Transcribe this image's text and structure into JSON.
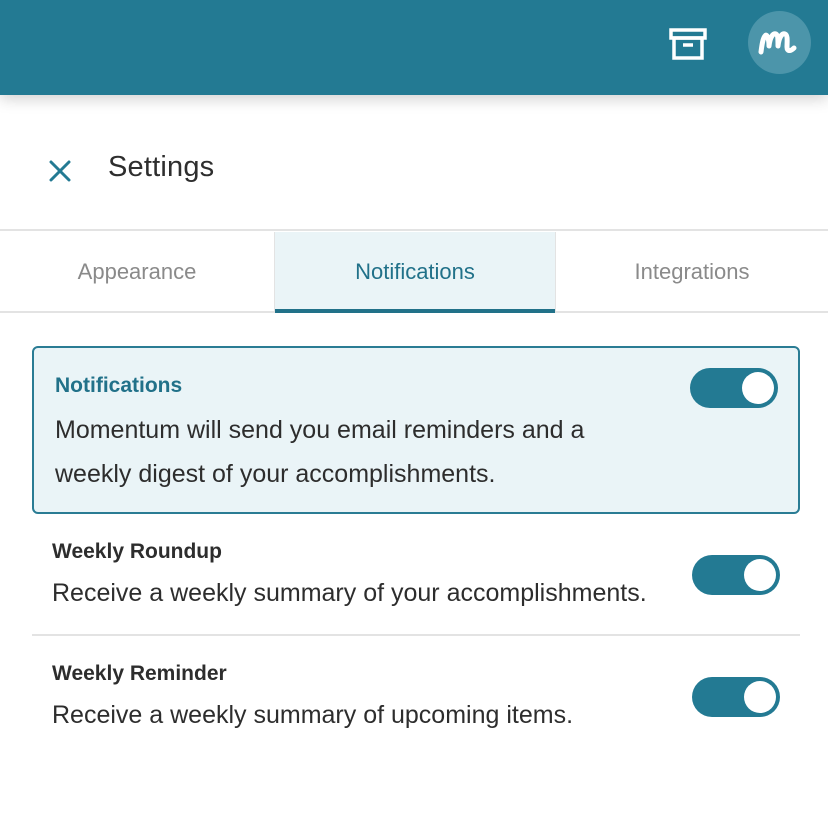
{
  "topbar": {
    "archive_icon": "archive-box-icon",
    "avatar_icon": "momentum-m-logo",
    "brand_color": "#237a93"
  },
  "header": {
    "title": "Settings",
    "close_icon": "close-x-icon"
  },
  "tabs": [
    {
      "label": "Appearance",
      "active": false
    },
    {
      "label": "Notifications",
      "active": true
    },
    {
      "label": "Integrations",
      "active": false
    }
  ],
  "notifications": {
    "title": "Notifications",
    "description": "Momentum will send you email reminders and a weekly digest of your accomplishments.",
    "enabled": true
  },
  "weekly_roundup": {
    "title": "Weekly Roundup",
    "description": "Receive a weekly summary of your accomplishments.",
    "enabled": true
  },
  "weekly_reminder": {
    "title": "Weekly Reminder",
    "description": "Receive a weekly summary of upcoming items.",
    "enabled": true
  },
  "colors": {
    "accent": "#237a93",
    "active_tab_bg": "#eaf4f7",
    "divider": "#e3e3e3"
  }
}
